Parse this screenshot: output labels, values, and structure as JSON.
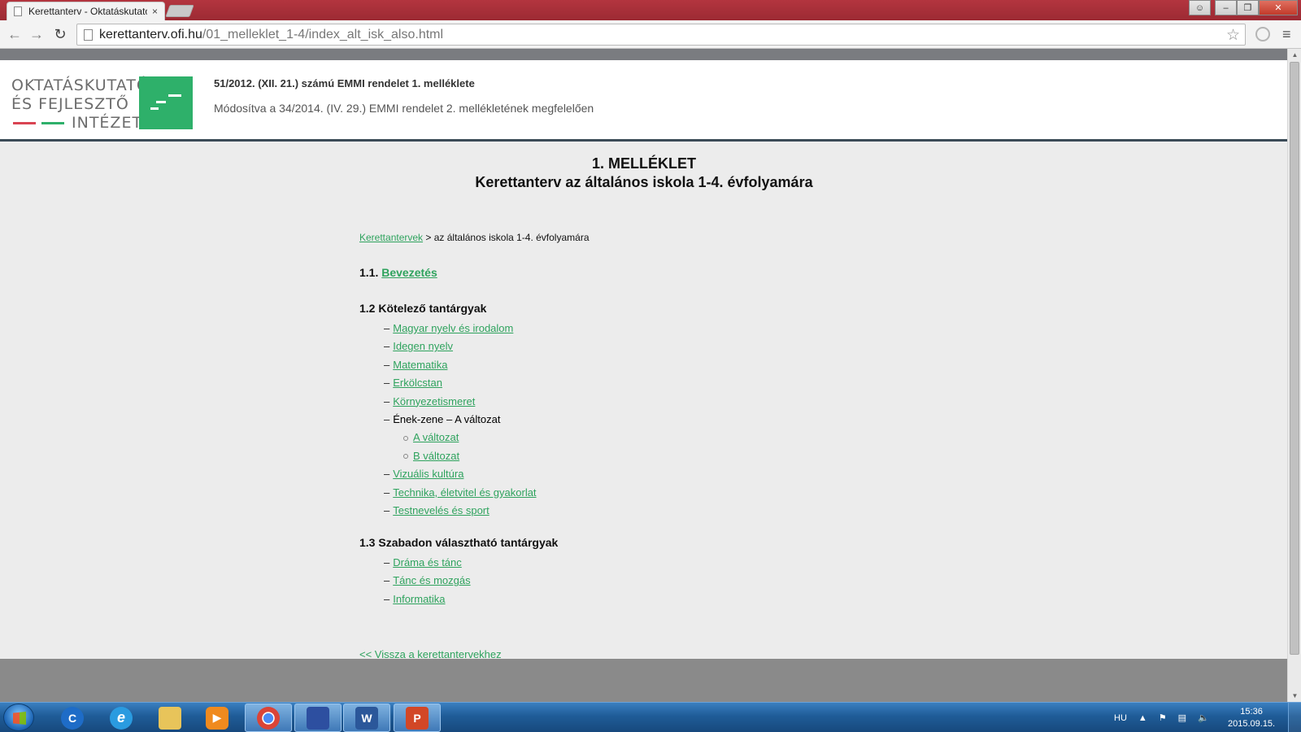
{
  "browser": {
    "tab_title": "Kerettanterv - Oktatáskutató",
    "tab_close": "×",
    "url_host": "kerettanterv.ofi.hu",
    "url_path": "/01_melleklet_1-4/index_alt_isk_also.html"
  },
  "header": {
    "logo_line1": "OKTATÁSKUTATÓ",
    "logo_line2": "ÉS FEJLESZTŐ",
    "logo_line3": "INTÉZET",
    "title": "51/2012. (XII. 21.) számú EMMI rendelet 1. melléklete",
    "subtitle": "Módosítva a 34/2014. (IV. 29.) EMMI rendelet 2. mellékletének megfelelően"
  },
  "page": {
    "heading_line1": "1. MELLÉKLET",
    "heading_line2": "Kerettanterv az általános iskola 1-4. évfolyamára",
    "breadcrumb_link": "Kerettantervek",
    "breadcrumb_rest": " > az általános iskola 1-4. évfolyamára",
    "sec1_prefix": "1.1. ",
    "sec1_link": "Bevezetés",
    "sec2_title": "1.2 Kötelező tantárgyak",
    "sec2_items": [
      "Magyar nyelv és irodalom",
      "Idegen nyelv",
      "Matematika",
      "Erkölcstan",
      "Környezetismeret",
      "Ének-zene – A változat",
      "A változat",
      "B változat",
      "Vizuális kultúra",
      "Technika, életvitel és gyakorlat",
      "Testnevelés és sport"
    ],
    "sec3_title": "1.3 Szabadon választható tantárgyak",
    "sec3_items": [
      "Dráma és tánc",
      "Tánc és mozgás",
      "Informatika"
    ],
    "back_link": "<< Vissza a kerettantervekhez"
  },
  "taskbar": {
    "lang": "HU",
    "time": "15:36",
    "date": "2015.09.15."
  },
  "colors": {
    "link": "#2fa35e",
    "brand_green": "#2eb06a",
    "brand_red": "#d94452",
    "titlebar": "#9c2a33"
  }
}
